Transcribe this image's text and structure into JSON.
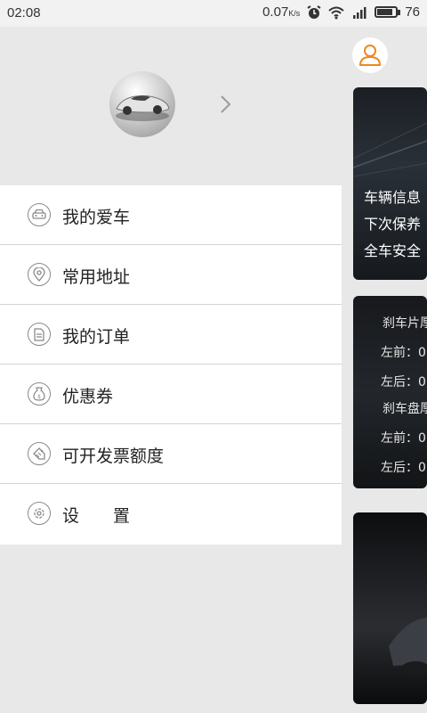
{
  "status_bar": {
    "time": "02:08",
    "speed": "0.07",
    "speed_unit": "K/s",
    "battery": "76",
    "icons": [
      "alarm-icon",
      "wifi-icon",
      "signal-3g-icon",
      "battery-icon"
    ]
  },
  "drawer": {
    "menu": [
      {
        "label": "我的爱车",
        "icon": "car-icon"
      },
      {
        "label": "常用地址",
        "icon": "location-pin-icon"
      },
      {
        "label": "我的订单",
        "icon": "document-icon"
      },
      {
        "label": "优惠券",
        "icon": "coupon-icon"
      },
      {
        "label": "可开发票额度",
        "icon": "tag-icon"
      },
      {
        "label": "设　　置",
        "icon": "gear-icon"
      }
    ]
  },
  "main": {
    "card1_lines": [
      "车辆信息",
      "下次保养",
      "全车安全"
    ],
    "card2_lines": [
      "刹车片厚",
      "左前：0",
      "左后：0",
      "刹车盘厚",
      "左前：0",
      "左后：0"
    ]
  },
  "colors": {
    "accent": "#f0871e",
    "menu_bg": "#ffffff",
    "drawer_bg": "#e8e8e8"
  }
}
